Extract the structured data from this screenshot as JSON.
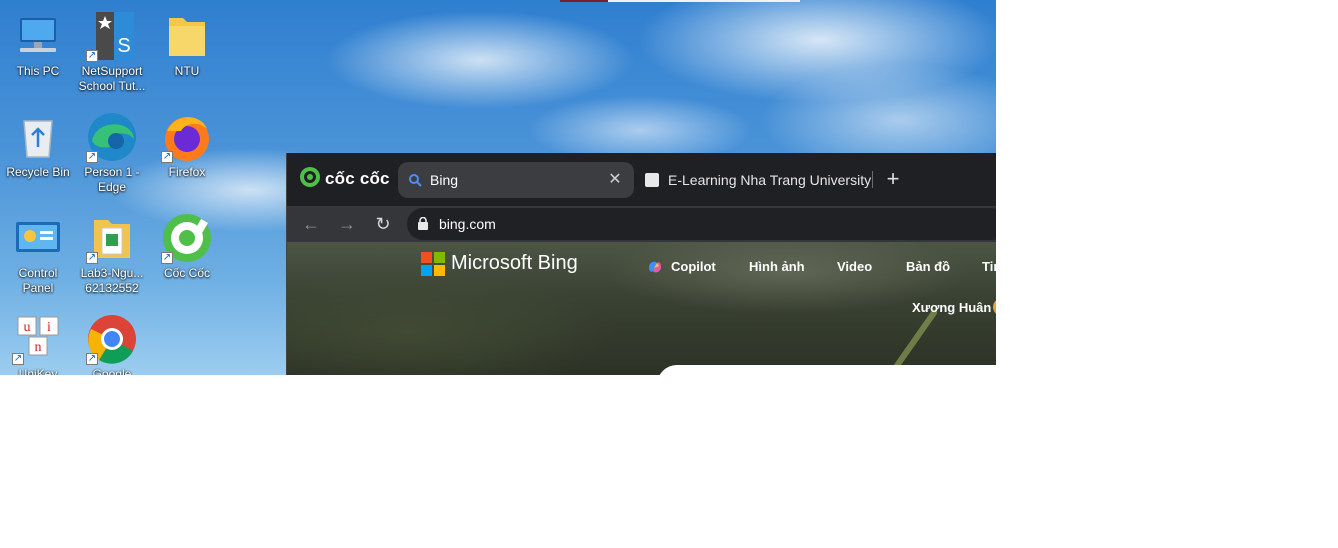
{
  "desktop": {
    "icons": [
      {
        "label": "This PC",
        "icon": "computer-icon"
      },
      {
        "label": "NetSupport School Tut...",
        "icon": "netsupport-icon"
      },
      {
        "label": "NTU",
        "icon": "folder-icon"
      },
      {
        "label": "Recycle Bin",
        "icon": "recycle-bin-icon"
      },
      {
        "label": "Person 1 - Edge",
        "icon": "edge-icon"
      },
      {
        "label": "Firefox",
        "icon": "firefox-icon"
      },
      {
        "label": "Control Panel",
        "icon": "control-panel-icon"
      },
      {
        "label": "Lab3-Ngu... 62132552",
        "icon": "document-folder-icon"
      },
      {
        "label": "Cốc Cốc",
        "icon": "coccoc-icon"
      },
      {
        "label": "UniKey",
        "icon": "unikey-icon"
      },
      {
        "label": "Google",
        "icon": "chrome-icon"
      }
    ]
  },
  "browser": {
    "brand": "cốc cốc",
    "tabs": [
      {
        "title": "Bing",
        "active": true,
        "icon": "search-icon"
      },
      {
        "title": "E-Learning Nha Trang University",
        "active": false,
        "icon": "elearning-icon"
      }
    ],
    "new_tab": "+",
    "close": "✕",
    "address": "bing.com",
    "nav": {
      "back": "←",
      "forward": "→",
      "reload": "↻"
    }
  },
  "bing": {
    "brand": "Microsoft Bing",
    "nav": [
      "Copilot",
      "Hình ảnh",
      "Video",
      "Bản đồ",
      "Tin"
    ],
    "user": "Xương Huân"
  },
  "colors": {
    "tabstrip": "#1f2023",
    "toolbar": "#35363a",
    "active_tab": "#3c3d41",
    "ms_red": "#f25022",
    "ms_green": "#7fba00",
    "ms_blue": "#00a4ef",
    "ms_yellow": "#ffb900"
  }
}
